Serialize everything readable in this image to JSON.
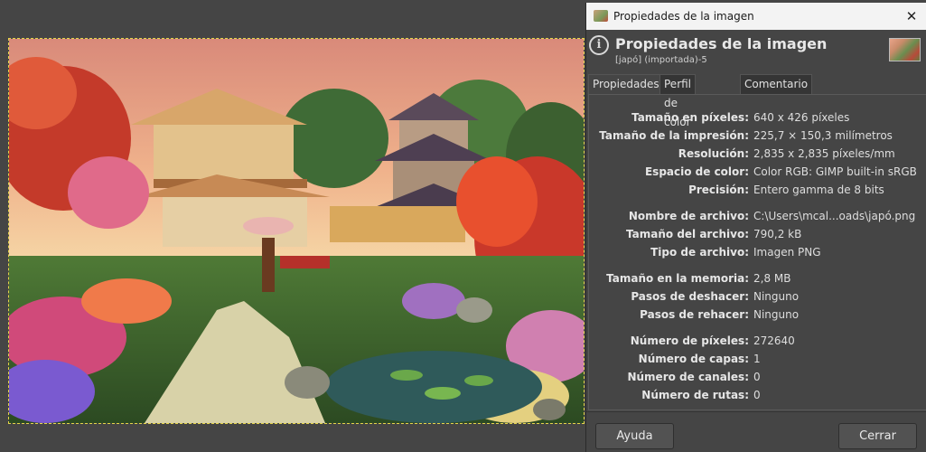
{
  "dialog": {
    "window_title": "Propiedades de la imagen",
    "heading": "Propiedades de la imagen",
    "subtitle": "[japó] (importada)-5",
    "tabs": [
      {
        "label": "Propiedades",
        "active": true
      },
      {
        "label": "Perfil de color",
        "active": false
      },
      {
        "label": "Comentario",
        "active": false
      }
    ],
    "properties": [
      {
        "label": "Tamaño en píxeles:",
        "value": "640 x 426 píxeles"
      },
      {
        "label": "Tamaño de la impresión:",
        "value": "225,7 × 150,3 milímetros"
      },
      {
        "label": "Resolución:",
        "value": "2,835 x 2,835 píxeles/mm"
      },
      {
        "label": "Espacio de color:",
        "value": "Color RGB: GIMP built-in sRGB"
      },
      {
        "label": "Precisión:",
        "value": "Entero gamma de 8 bits"
      },
      {
        "label": "Nombre de archivo:",
        "value": "C:\\Users\\mcal...oads\\japó.png"
      },
      {
        "label": "Tamaño del archivo:",
        "value": "790,2 kB"
      },
      {
        "label": "Tipo de archivo:",
        "value": "Imagen PNG"
      },
      {
        "label": "Tamaño en la memoria:",
        "value": "2,8 MB"
      },
      {
        "label": "Pasos de deshacer:",
        "value": "Ninguno"
      },
      {
        "label": "Pasos de rehacer:",
        "value": "Ninguno"
      },
      {
        "label": "Número de píxeles:",
        "value": "272640"
      },
      {
        "label": "Número de capas:",
        "value": "1"
      },
      {
        "label": "Número de canales:",
        "value": "0"
      },
      {
        "label": "Número de rutas:",
        "value": "0"
      }
    ],
    "buttons": {
      "help": "Ayuda",
      "close": "Cerrar"
    },
    "close_glyph": "✕"
  },
  "colors": {
    "background": "#454545",
    "selection": "#e5d44a",
    "titlebar": "#f3f3f3"
  }
}
